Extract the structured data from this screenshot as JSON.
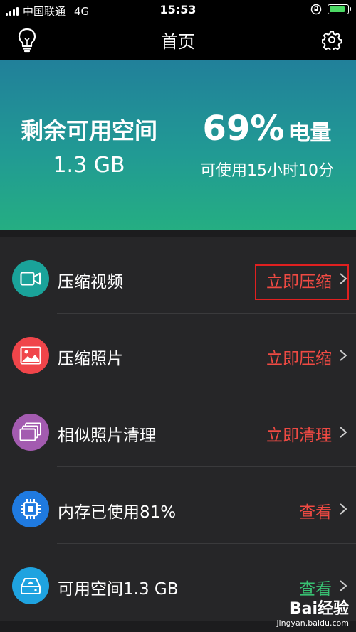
{
  "status": {
    "carrier": "中国联通",
    "network": "4G",
    "time": "15:53",
    "battery_level": 0.9
  },
  "nav": {
    "title": "首页",
    "left_icon": "lightbulb-icon",
    "right_icon": "gear-icon"
  },
  "hero": {
    "storage_label": "剩余可用空间",
    "storage_value": "1.3 GB",
    "battery_percent": "69%",
    "battery_unit": "电量",
    "battery_time": "可使用15小时10分"
  },
  "list": {
    "items": [
      {
        "label": "压缩视频",
        "action": "立即压缩",
        "icon": "video-camera-icon",
        "icon_color": "#1aa39a",
        "action_color": "#ef4a43"
      },
      {
        "label": "压缩照片",
        "action": "立即压缩",
        "icon": "image-icon",
        "icon_color": "#f0454a",
        "action_color": "#ef4a43"
      },
      {
        "label": "相似照片清理",
        "action": "立即清理",
        "icon": "photos-stack-icon",
        "icon_color": "#a35bb0",
        "action_color": "#ef4a43"
      },
      {
        "label": "内存已使用81%",
        "action": "查看",
        "icon": "chip-icon",
        "icon_color": "#1f7ae0",
        "action_color": "#ef4a43"
      },
      {
        "label": "可用空间1.3 GB",
        "action": "查看",
        "icon": "disk-icon",
        "icon_color": "#1fa3e0",
        "action_color": "#38c172"
      }
    ]
  },
  "watermark": {
    "brand": "Bai经验",
    "url": "jingyan.baidu.com"
  }
}
